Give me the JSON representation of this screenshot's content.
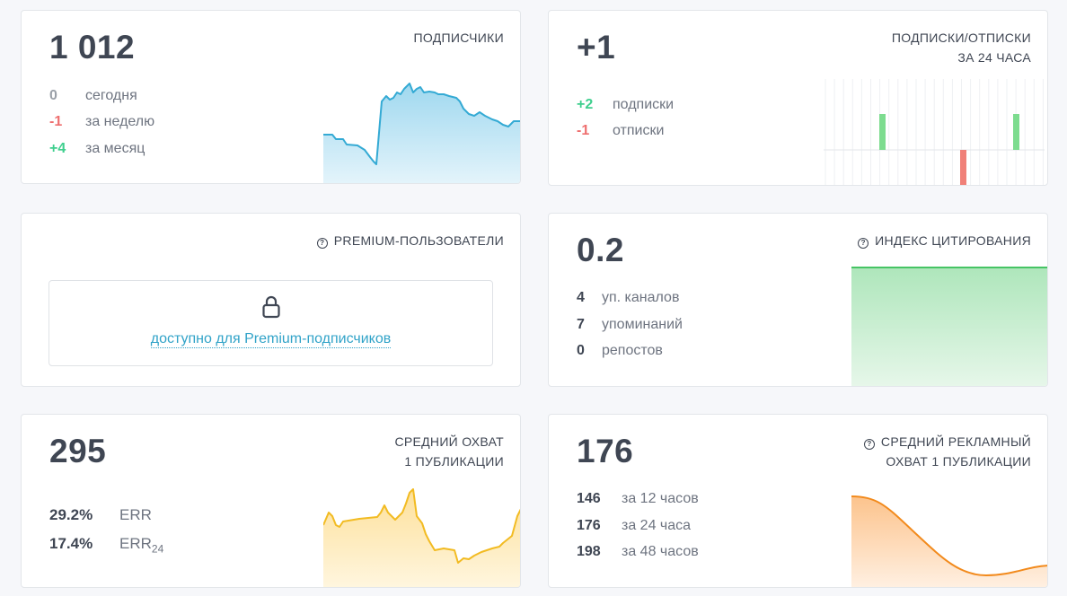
{
  "subscribers": {
    "value": "1 012",
    "title": "ПОДПИСЧИКИ",
    "rows": [
      {
        "num": "0",
        "label": "сегодня",
        "tone": "gray"
      },
      {
        "num": "-1",
        "label": "за неделю",
        "tone": "red"
      },
      {
        "num": "+4",
        "label": "за месяц",
        "tone": "green"
      }
    ],
    "color": "#34aad4"
  },
  "subs_unsubs": {
    "value": "+1",
    "title_line1": "ПОДПИСКИ/ОТПИСКИ",
    "title_line2": "ЗА 24 ЧАСА",
    "rows": [
      {
        "num": "+2",
        "label": "подписки",
        "tone": "green"
      },
      {
        "num": "-1",
        "label": "отписки",
        "tone": "red"
      }
    ],
    "colors": {
      "up": "#7ddc8f",
      "down": "#f08078"
    }
  },
  "premium": {
    "title": "PREMIUM-ПОЛЬЗОВАТЕЛИ",
    "link": "доступно для Premium-подписчиков"
  },
  "citation": {
    "value": "0.2",
    "title": "ИНДЕКС ЦИТИРОВАНИЯ",
    "rows": [
      {
        "num": "4",
        "label": "уп. каналов"
      },
      {
        "num": "7",
        "label": "упоминаний"
      },
      {
        "num": "0",
        "label": "репостов"
      }
    ],
    "color": "#46c464"
  },
  "reach": {
    "value": "295",
    "title_line1": "СРЕДНИЙ ОХВАТ",
    "title_line2": "1 ПУБЛИКАЦИИ",
    "err": {
      "num": "29.2%",
      "label": "ERR"
    },
    "err24": {
      "num": "17.4%",
      "label": "ERR",
      "sub": "24"
    },
    "color": "#f2bb22"
  },
  "ad_reach": {
    "value": "176",
    "title_line1": "СРЕДНИЙ РЕКЛАМНЫЙ",
    "title_line2": "ОХВАТ 1 ПУБЛИКАЦИИ",
    "rows": [
      {
        "num": "146",
        "label": "за 12 часов"
      },
      {
        "num": "176",
        "label": "за 24 часа"
      },
      {
        "num": "198",
        "label": "за 48 часов"
      }
    ],
    "color": "#f28a1c"
  }
}
